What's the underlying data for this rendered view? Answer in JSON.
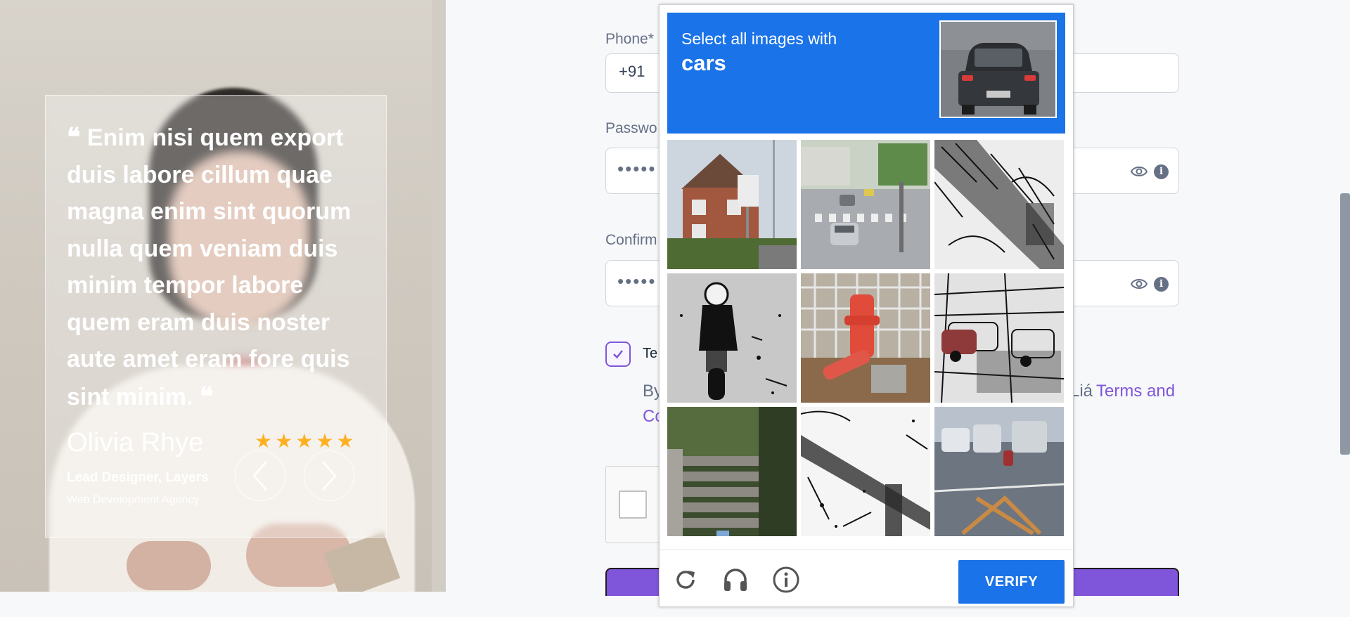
{
  "testimonial": {
    "quote": "Enim nisi quem export duis labore cillum quae magna enim sint quorum nulla quem veniam duis minim tempor labore quem eram duis noster aute amet eram fore quis sint minim.",
    "open_mark": "❝",
    "close_mark": "❝",
    "author_name": "Olivia Rhye",
    "author_role": "Lead Designer, Layers",
    "author_org": "Web Development Agency",
    "rating": 5,
    "star_glyph": "★",
    "star_color": "#fdb022"
  },
  "form": {
    "phone_label": "Phone*",
    "phone_prefix": "+91",
    "password_label": "Passwo",
    "password_value": "•••••",
    "confirm_label": "Confirm",
    "confirm_value": "•••••",
    "terms_short": "Te",
    "consent_start": "By",
    "consent_mid": "Liá",
    "consent_link": "Terms and",
    "consent_link_cont": "Co",
    "accent_color": "#7f56d9"
  },
  "captcha": {
    "instruction": "Select all images with",
    "target": "cars",
    "verify_label": "VERIFY",
    "accent_color": "#1a73e8",
    "tiles": [
      "house-street",
      "crosswalk-cars",
      "sketch-pattern",
      "motorcycle",
      "fire-hydrant",
      "sketch-cars",
      "stairs",
      "bridge-sketch",
      "road-traffic"
    ],
    "footer_icons": [
      "reload-icon",
      "audio-icon",
      "info-icon"
    ]
  }
}
